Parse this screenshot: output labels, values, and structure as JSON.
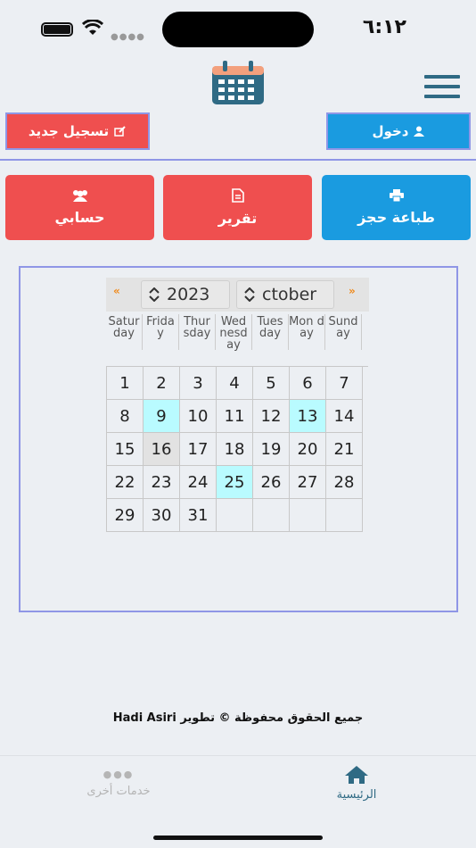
{
  "status": {
    "time": "٦:١٢"
  },
  "header": {
    "logo_icon": "calendar-icon",
    "menu_icon": "hamburger-icon"
  },
  "top_buttons": {
    "login_label": "دخول",
    "register_label": "تسجيل جديد"
  },
  "actions": {
    "print_label": "طباعة حجز",
    "report_label": "تقرير",
    "account_label": "حسابي"
  },
  "calendar": {
    "prev_nav": "«",
    "next_nav": "»",
    "year": "2023",
    "month": "ctober",
    "weekdays": [
      "Satur day",
      "Frida y",
      "Thur sday",
      "Wed nesd ay",
      "Tues day",
      "Mon day",
      "Sund ay"
    ],
    "days": [
      [
        "1",
        "2",
        "3",
        "4",
        "5",
        "6",
        "7"
      ],
      [
        "8",
        "9",
        "10",
        "11",
        "12",
        "13",
        "14"
      ],
      [
        "15",
        "16",
        "17",
        "18",
        "19",
        "20",
        "21"
      ],
      [
        "22",
        "23",
        "24",
        "25",
        "26",
        "27",
        "28"
      ],
      [
        "29",
        "30",
        "31",
        "",
        "",
        "",
        ""
      ]
    ],
    "highlighted": [
      "9",
      "13",
      "25"
    ],
    "today": "16"
  },
  "footer": {
    "copyright": "جميع الحقوق محفوظة © تطوير Hadi Asiri"
  },
  "tabbar": {
    "home_label": "الرئيسية",
    "more_label": "خدمات أخرى"
  },
  "colors": {
    "blue": "#1a9be0",
    "red": "#ef4f4f",
    "teal": "#2f6a84",
    "highlight": "#b9fbff"
  }
}
